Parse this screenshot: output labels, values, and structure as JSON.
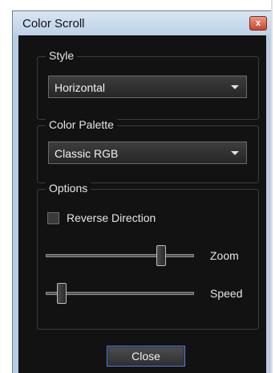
{
  "window": {
    "title": "Color Scroll",
    "close_glyph": "x"
  },
  "style_group": {
    "label": "Style",
    "selected": "Horizontal"
  },
  "palette_group": {
    "label": "Color Palette",
    "selected": "Classic RGB"
  },
  "options_group": {
    "label": "Options",
    "reverse_direction": {
      "label": "Reverse Direction",
      "checked": false
    },
    "zoom": {
      "label": "Zoom",
      "value": 0.8
    },
    "speed": {
      "label": "Speed",
      "value": 0.08
    }
  },
  "footer": {
    "close_label": "Close"
  },
  "colors": {
    "client_bg": "#121212",
    "button_border": "#5b7fd0",
    "titlebar": "#bdd1e6"
  },
  "icons": {
    "close": "close-icon",
    "dropdown": "chevron-down-icon"
  }
}
